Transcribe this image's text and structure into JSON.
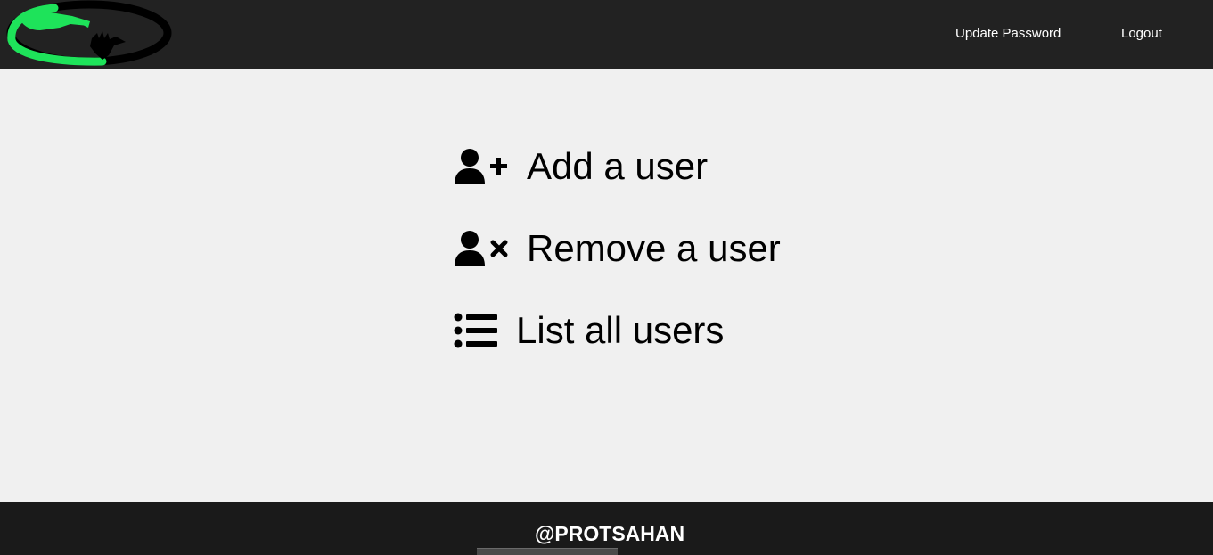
{
  "navbar": {
    "logo": "hands-circle-logo",
    "links": {
      "update_password": "Update Password",
      "logout": "Logout"
    }
  },
  "main": {
    "actions": [
      {
        "label": "Add a user",
        "icon": "user-plus-icon"
      },
      {
        "label": "Remove a user",
        "icon": "user-xmark-icon"
      },
      {
        "label": "List all users",
        "icon": "list-icon"
      }
    ]
  },
  "footer": {
    "text": "@PROTSAHAN"
  },
  "colors": {
    "navbar_bg": "#222222",
    "page_bg": "#f0f0f0",
    "footer_bg": "#1a1a1a",
    "logo_green": "#1ee35a"
  }
}
